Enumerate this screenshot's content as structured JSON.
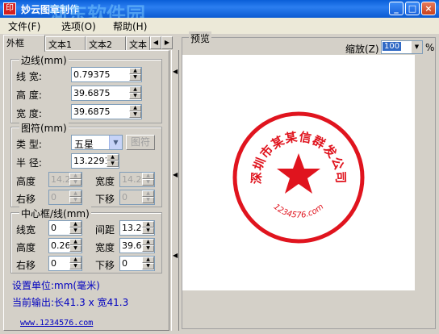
{
  "window": {
    "title": "妙云图章制作",
    "watermark": "河东软件园",
    "icon": "seal-app-icon"
  },
  "menu": [
    "文件(F)",
    "选项(O)",
    "帮助(H)"
  ],
  "tabs": [
    "外框",
    "文本1",
    "文本2",
    "文本"
  ],
  "border_group": {
    "legend": "边线(mm)",
    "line_width_label": "线 宽:",
    "line_width": "0.79375",
    "height_label": "高 度:",
    "height": "39.6875",
    "width_label": "宽 度:",
    "width": "39.6875"
  },
  "symbol_group": {
    "legend": "图符(mm)",
    "type_label": "类 型:",
    "type_value": "五星",
    "symbol_button": "图符",
    "radius_label": "半 径:",
    "radius": "13.2291",
    "height_label": "高度",
    "height": "14.2",
    "width_label": "宽度",
    "width": "14.2",
    "right_label": "右移",
    "right": "0",
    "down_label": "下移",
    "down": "0"
  },
  "center_group": {
    "legend": "中心框/线(mm)",
    "line_width_label": "线宽",
    "line_width": "0",
    "spacing_label": "间距",
    "spacing": "13.2",
    "height_label": "高度",
    "height": "0.26",
    "width_label": "宽度",
    "width": "39.6",
    "right_label": "右移",
    "right": "0",
    "down_label": "下移",
    "down": "0"
  },
  "unit_text": "设置单位:mm(毫米)",
  "output_text": "当前输出:长41.3 x 宽41.3",
  "website": "www.1234576.com",
  "preview": {
    "legend": "预览",
    "zoom_label": "缩放(Z)",
    "zoom_value": "100",
    "zoom_unit": "%"
  },
  "seal": {
    "main_text": "深圳市某某信群发公司",
    "bottom_text": "1234576.com",
    "color": "#e0141e"
  },
  "colors": {
    "titlebar": "#0a5fd8",
    "face": "#d4d0c8",
    "seal_red": "#e0141e"
  }
}
